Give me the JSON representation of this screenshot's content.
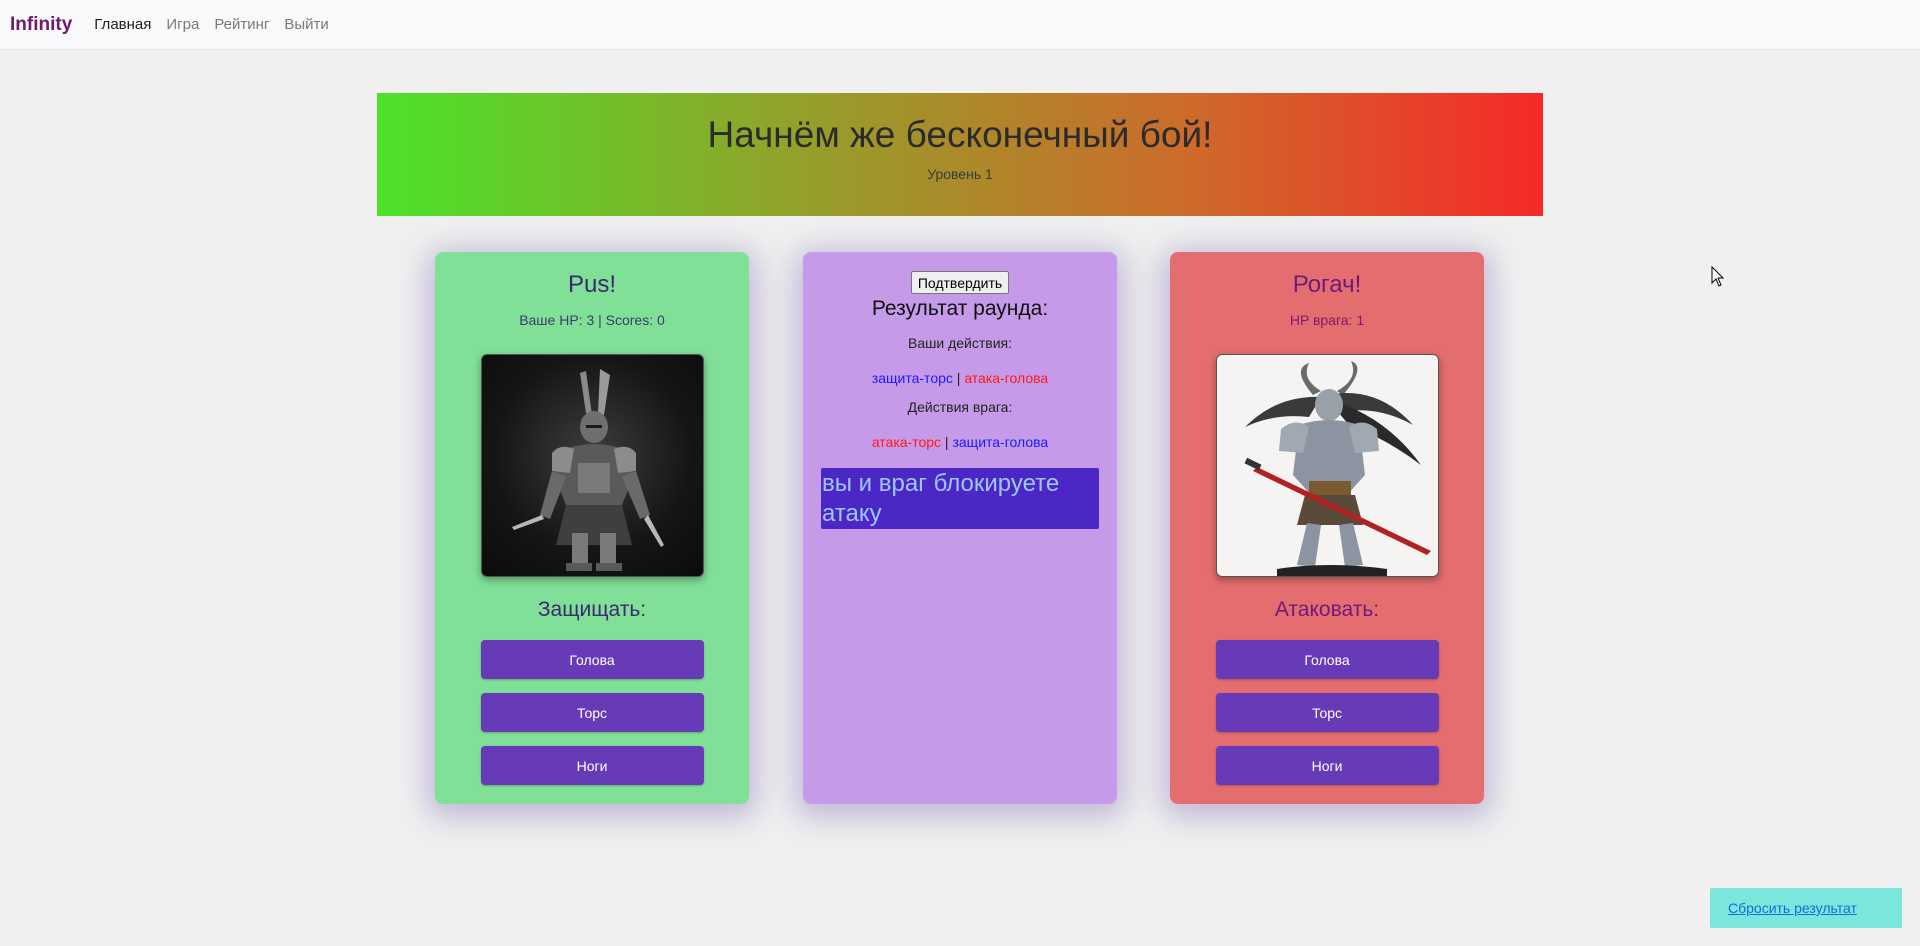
{
  "nav": {
    "brand": "Infinity",
    "links": [
      "Главная",
      "Игра",
      "Рейтинг",
      "Выйти"
    ]
  },
  "banner": {
    "title": "Начнём же бесконечный бой!",
    "level": "Уровень 1"
  },
  "player": {
    "name": "Pus!",
    "stats": "Ваше HP: 3 | Scores: 0",
    "action_title": "Защищать:",
    "buttons": [
      "Голова",
      "Торс",
      "Ноги"
    ]
  },
  "result": {
    "confirm_label": "Подтвердить",
    "title": "Результат раунда:",
    "your_actions_label": "Ваши действия:",
    "your_actions": {
      "first": "защита-торс",
      "sep": " | ",
      "second": "атака-голова"
    },
    "enemy_actions_label": "Действия врага:",
    "enemy_actions": {
      "first": "атака-торс",
      "sep": " | ",
      "second": "защита-голова"
    },
    "message": "вы и враг блокируете атаку"
  },
  "enemy": {
    "name": "Рогач!",
    "stats": "HP врага: 1",
    "action_title": "Атаковать:",
    "buttons": [
      "Голова",
      "Торс",
      "Ноги"
    ]
  },
  "reset_label": "Сбросить результат",
  "colors": {
    "accent": "#673ab7",
    "player_card": "#80e098",
    "result_card": "#c59ae8",
    "enemy_card": "#e46d6f",
    "defense_text": "#1a1aff",
    "attack_text": "#ff1a1a"
  }
}
